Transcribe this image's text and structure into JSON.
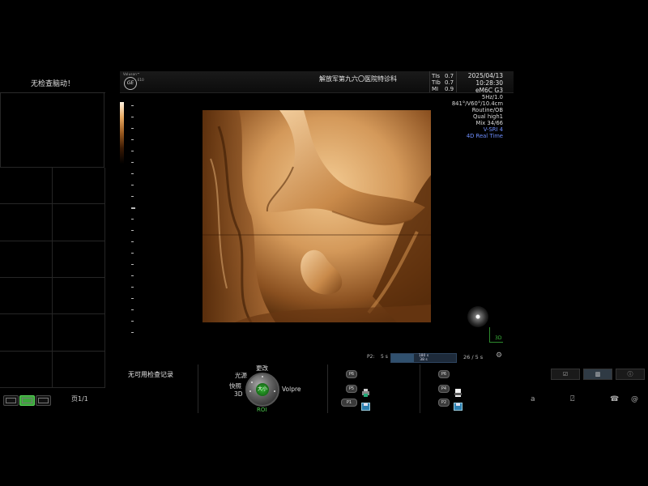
{
  "left_panel": {
    "title": "无检查脑动！",
    "page_label": "页1/1"
  },
  "header": {
    "logo_voluson": "Voluson™",
    "logo_ge": "GE",
    "logo_model": "E10",
    "hospital": "解放军第九六〇医院特诊科",
    "indices": [
      {
        "name": "TIs",
        "value": "0.7"
      },
      {
        "name": "TIb",
        "value": "0.7"
      },
      {
        "name": "MI",
        "value": "0.9"
      }
    ],
    "date": "2025/04/13",
    "time": "10:28:30",
    "probe": "eM6C G3"
  },
  "params": {
    "freq": "5Hz/1.0",
    "geometry": "841°/V60°/10.4cm",
    "preset": "Routine/OB",
    "quality": "Qual high1",
    "mix": "Mix 34/66",
    "vsri": "V-SRI 4",
    "mode": "4D Real Time"
  },
  "image": {
    "label_3d": "3D"
  },
  "timeline": {
    "label": "P2:",
    "left_value": "5 s",
    "bar_top": "180 s",
    "bar_bottom": "38 s",
    "right_value": "26 / 5 s",
    "fill_fraction": 0.35
  },
  "controls": {
    "no_record": "无可用检查记录",
    "knob_top": "更改",
    "knob_left_top": "光源",
    "knob_left_mid": "快照",
    "knob_left_bottom": "3D",
    "knob_center": "大小",
    "knob_right": "Volpre",
    "knob_bottom": "ROI"
  },
  "p_buttons_left": [
    "P6",
    "P5",
    "P1"
  ],
  "p_buttons_right": [
    "P6",
    "P4",
    "P2"
  ],
  "tabs": [
    "☑",
    "▥",
    "ⓘ"
  ],
  "bottom_icons": [
    "a",
    "⍁",
    "☎",
    "@"
  ],
  "colors": {
    "accent_green": "#3aa63a",
    "mode_blue": "#6f8fff",
    "image_sepia": "#c07838"
  }
}
